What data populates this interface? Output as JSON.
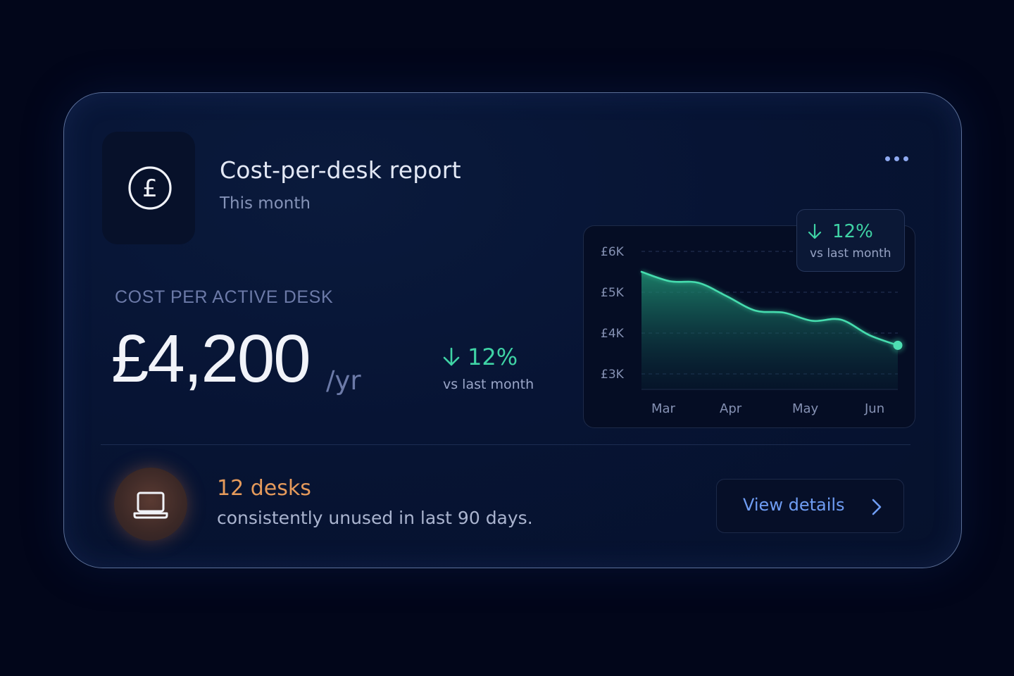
{
  "header": {
    "title": "Cost-per-desk report",
    "subtitle": "This month"
  },
  "icons": {
    "currency": "pound-circle-icon",
    "menu": "more-horizontal-icon",
    "trend": "arrow-down-icon",
    "device": "laptop-icon",
    "chevron": "chevron-right-icon"
  },
  "metric": {
    "label": "COST PER ACTIVE DESK",
    "value": "£4,200",
    "unit": "/yr",
    "delta": "12%",
    "delta_caption": "vs last month"
  },
  "chart_badge": {
    "delta": "12%",
    "caption": "vs last month"
  },
  "chart_data": {
    "type": "area",
    "x_labels": [
      "Mar",
      "Apr",
      "May",
      "Jun"
    ],
    "y_tick_labels": [
      "£6K",
      "£5K",
      "£4K",
      "£3K"
    ],
    "ylim": [
      3000,
      6000
    ],
    "grid": true,
    "series": [
      {
        "values": [
          5500,
          5270,
          5230,
          4900,
          4550,
          4500,
          4300,
          4330,
          3950,
          3700
        ]
      }
    ]
  },
  "unused": {
    "count": "12 desks",
    "description": "consistently unused in last 90 days."
  },
  "actions": {
    "view_details": "View details"
  },
  "colors": {
    "background": "#02061a",
    "card": "#071434",
    "accent_green": "#3fd3a5",
    "accent_orange": "#e59a5b",
    "accent_blue": "#6f9df3"
  }
}
